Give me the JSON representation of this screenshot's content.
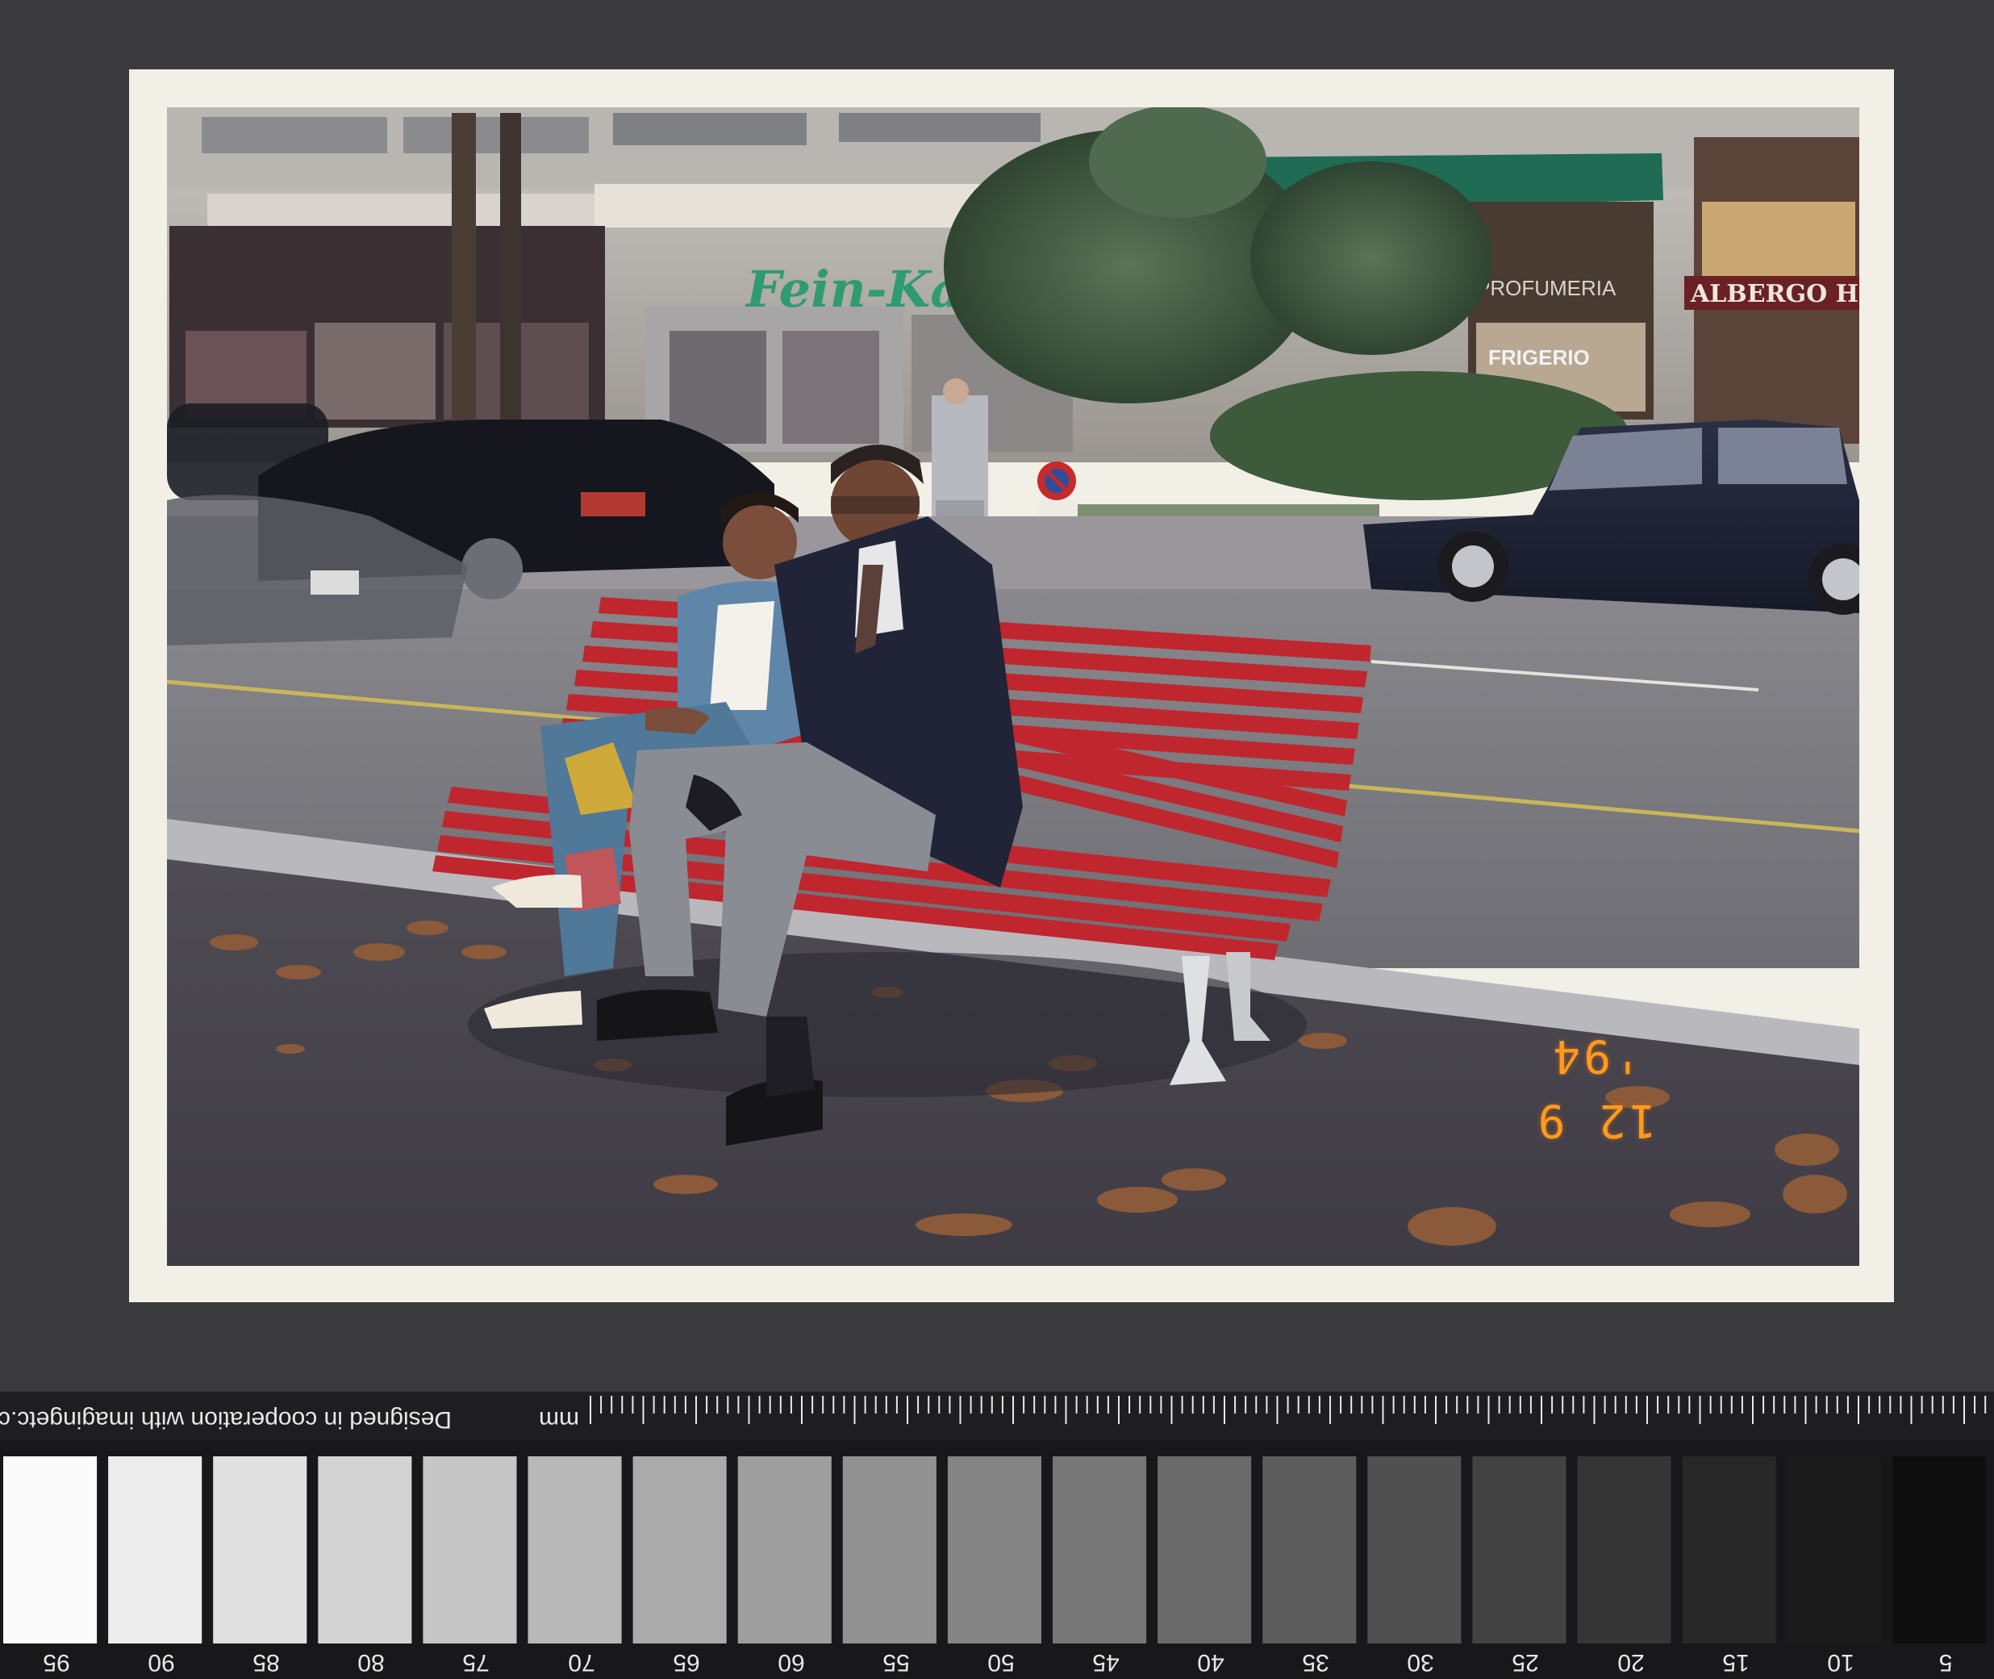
{
  "photo": {
    "date_stamp": "12 9 '94",
    "signs": {
      "fein_kaller": "Fein-Kaller",
      "albergo": "ALBERGO HO",
      "profumeria": "PROFUMERIA",
      "frigerio": "FRIGERIO"
    }
  },
  "target": {
    "credit": "Designed in cooperation with imagingetc.com",
    "unit": "mm",
    "gray_labels": [
      "95",
      "90",
      "85",
      "80",
      "75",
      "70",
      "65",
      "60",
      "55",
      "50",
      "45",
      "40",
      "35",
      "30",
      "25",
      "20",
      "15",
      "10",
      "5"
    ]
  },
  "colors": {
    "mat": "#3b3b3d",
    "bench": "#c0262e",
    "print_border": "#f1efe6",
    "datestamp": "#ff9a1e"
  }
}
